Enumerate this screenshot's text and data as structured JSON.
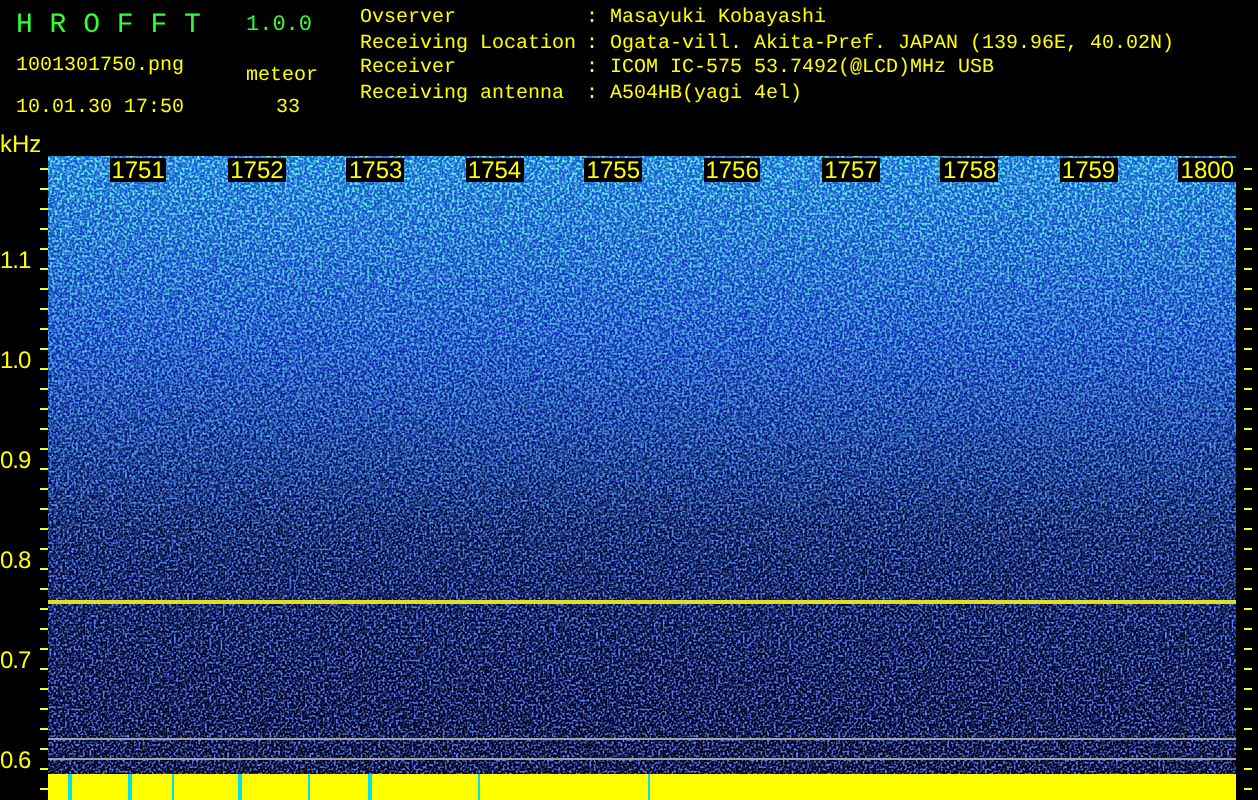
{
  "app": {
    "name": "H R O F F T",
    "version": "1.0.0",
    "file": "1001301750.png",
    "datetime": "10.01.30 17:50",
    "count_label": "meteor",
    "count": "33"
  },
  "info": [
    {
      "label": "Ovserver",
      "separator": ":",
      "value": "Masayuki Kobayashi"
    },
    {
      "label": "Receiving Location",
      "separator": ":",
      "value": "Ogata-vill. Akita-Pref. JAPAN (139.96E, 40.02N)"
    },
    {
      "label": "Receiver",
      "separator": ":",
      "value": "ICOM IC-575 53.7492(@LCD)MHz USB"
    },
    {
      "label": "Receiving antenna",
      "separator": ":",
      "value": "A504HB(yagi 4el)"
    }
  ],
  "spectrogram": {
    "unit": "kHz",
    "time_labels": [
      "1751",
      "1752",
      "1753",
      "1754",
      "1755",
      "1756",
      "1757",
      "1758",
      "1759",
      "1800"
    ],
    "frequency_labels": [
      "1.1",
      "1.0",
      "0.9",
      "0.8",
      "0.7",
      "0.6"
    ]
  }
}
